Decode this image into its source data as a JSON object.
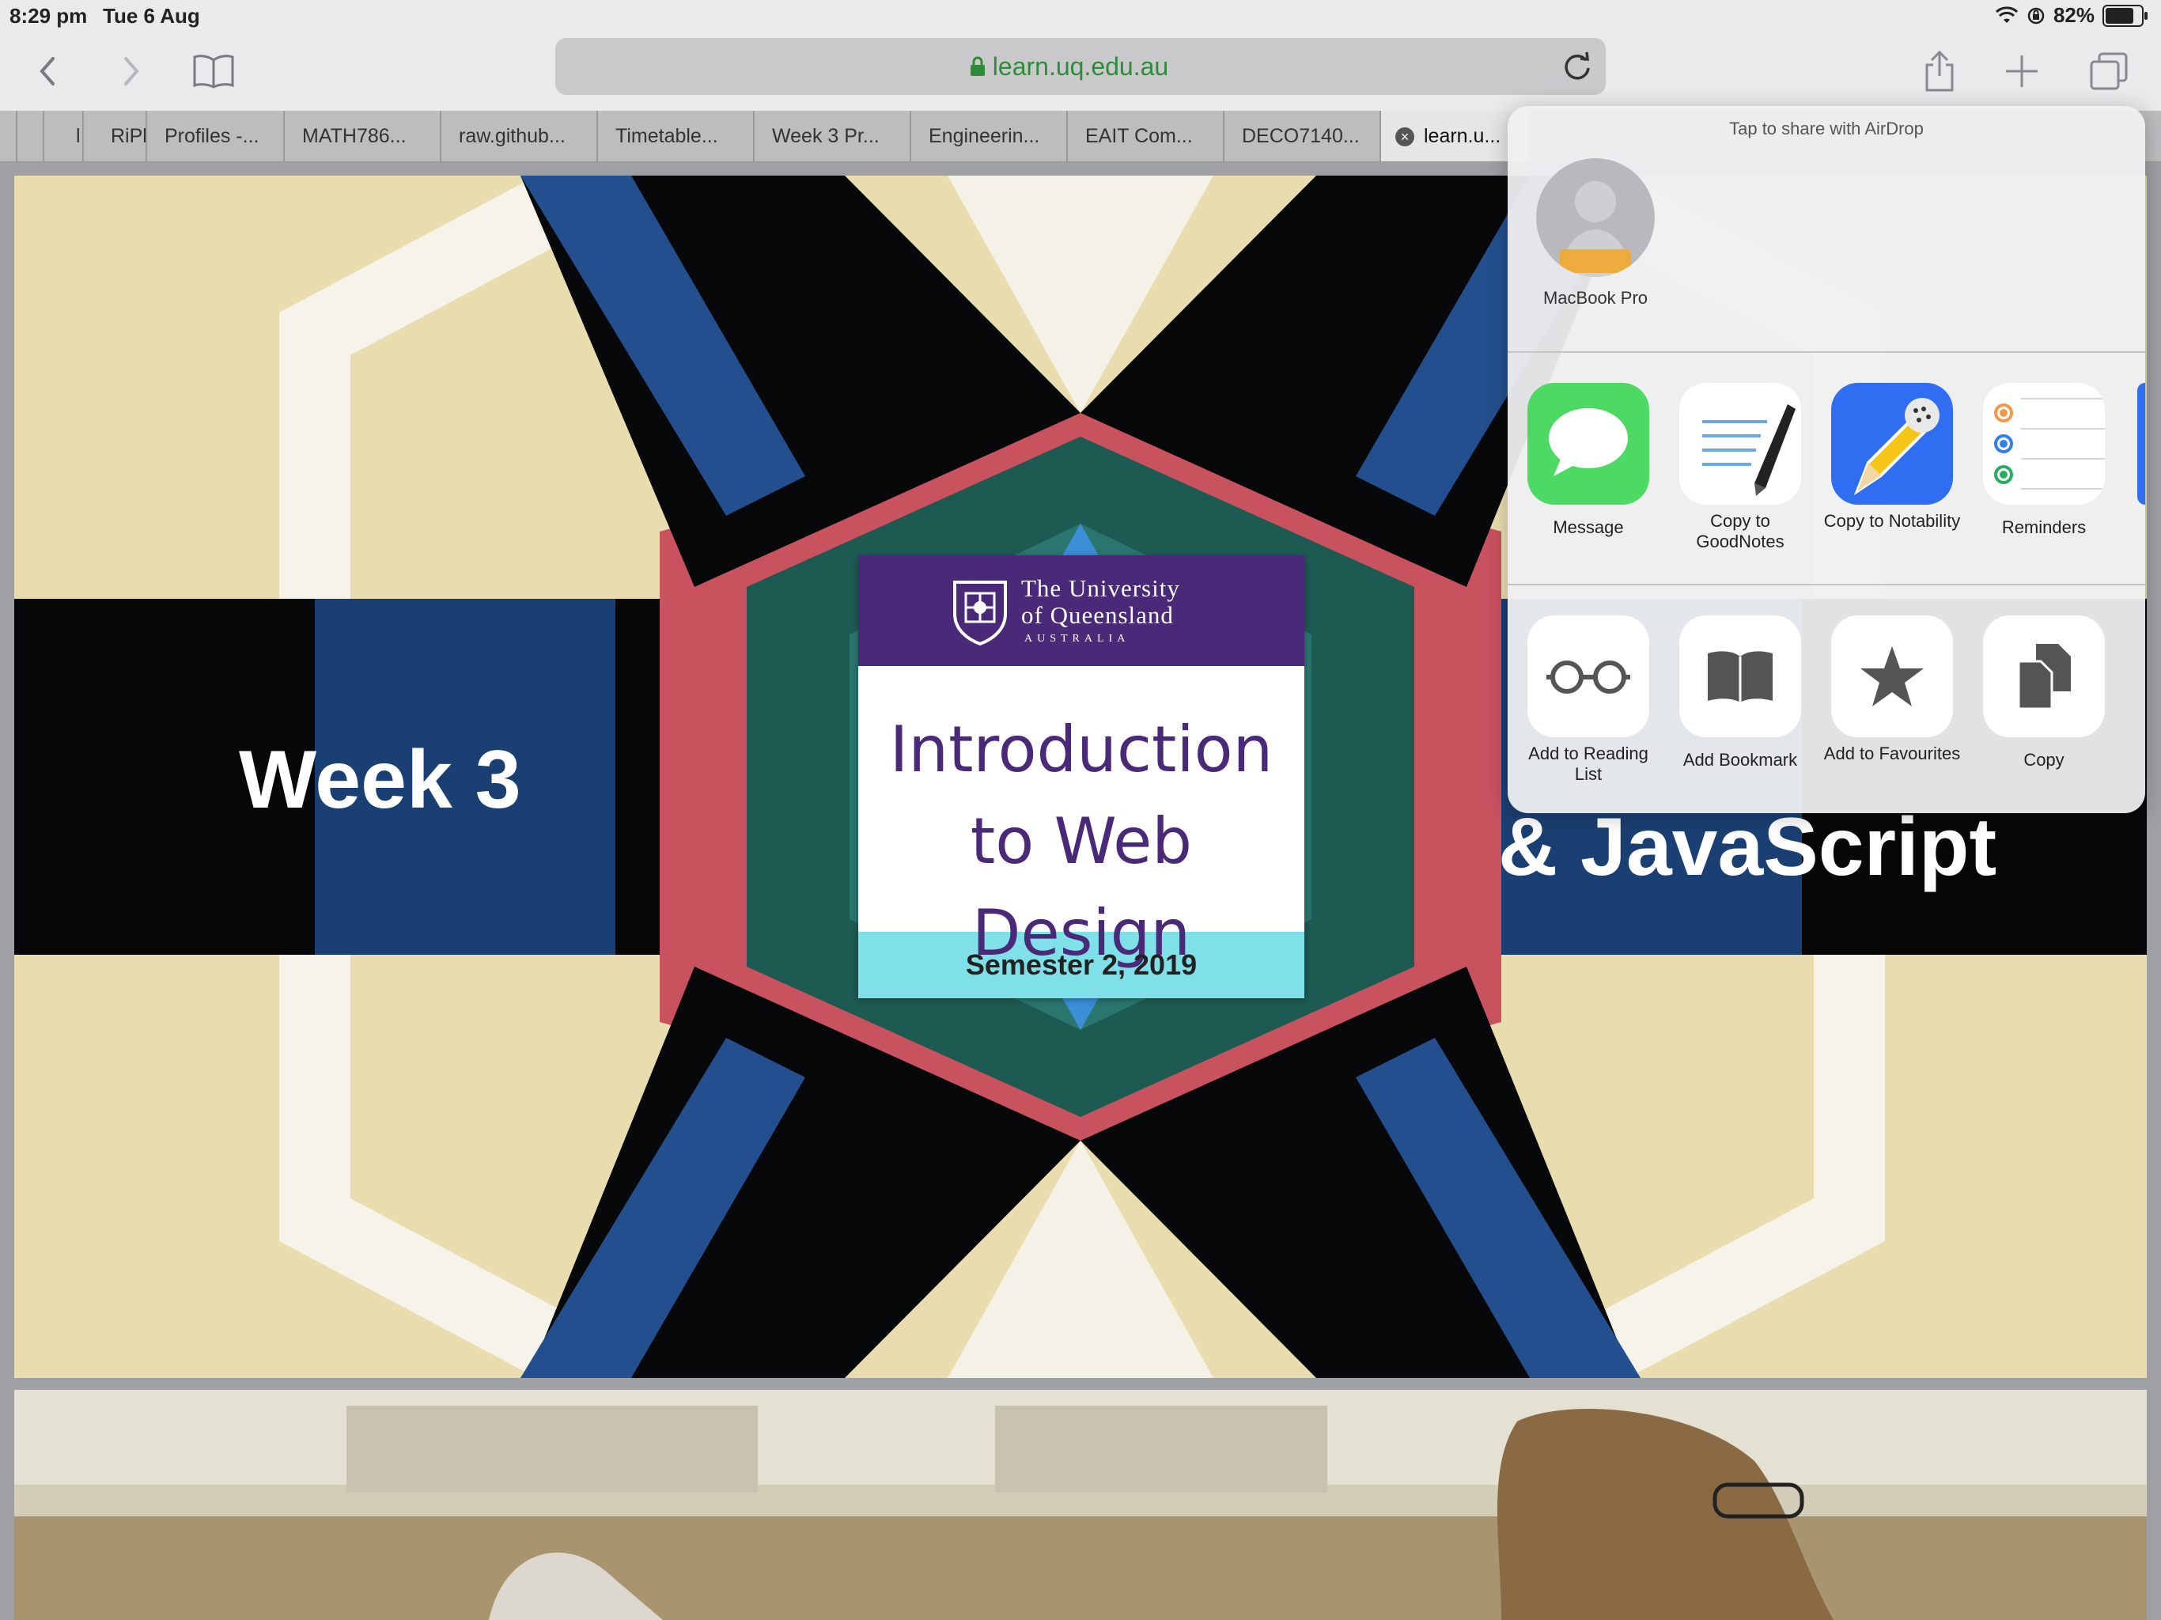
{
  "status_bar": {
    "time": "8:29 pm",
    "date": "Tue 6 Aug",
    "battery": "82%"
  },
  "toolbar": {
    "url": "learn.uq.edu.au"
  },
  "tabs": [
    {
      "label": "l"
    },
    {
      "label": "RiPl"
    },
    {
      "label": "Profiles -..."
    },
    {
      "label": "MATH786..."
    },
    {
      "label": "raw.github..."
    },
    {
      "label": "Timetable..."
    },
    {
      "label": "Week 3 Pr..."
    },
    {
      "label": "Engineerin..."
    },
    {
      "label": "EAIT Com..."
    },
    {
      "label": "DECO7140..."
    },
    {
      "label": "learn.u..."
    }
  ],
  "hero": {
    "left_text": "Week 3",
    "right_text": "& JavaScript",
    "card": {
      "uni_line1": "The University",
      "uni_line2": "of Queensland",
      "uni_line3": "AUSTRALIA",
      "title_line1": "Introduction",
      "title_line2": "to Web Design",
      "semester": "Semester 2, 2019"
    }
  },
  "share_sheet": {
    "airdrop_title": "Tap to share with AirDrop",
    "device_name": "MacBook Pro",
    "apps": [
      {
        "label": "Message",
        "icon": "message-icon"
      },
      {
        "label": "Copy to GoodNotes",
        "icon": "goodnotes-icon"
      },
      {
        "label": "Copy to Notability",
        "icon": "notability-icon"
      },
      {
        "label": "Reminders",
        "icon": "reminders-icon"
      }
    ],
    "actions": [
      {
        "label": "Add to Reading List",
        "icon": "glasses-icon"
      },
      {
        "label": "Add Bookmark",
        "icon": "book-icon"
      },
      {
        "label": "Add to Favourites",
        "icon": "star-icon"
      },
      {
        "label": "Copy",
        "icon": "copy-icon"
      }
    ]
  },
  "colors": {
    "uq_purple": "#4a2a78",
    "semester_band": "#7fe0e8",
    "url_green": "#2e8b3a",
    "message_green": "#4cd964",
    "notability_blue": "#2f6ef0"
  }
}
